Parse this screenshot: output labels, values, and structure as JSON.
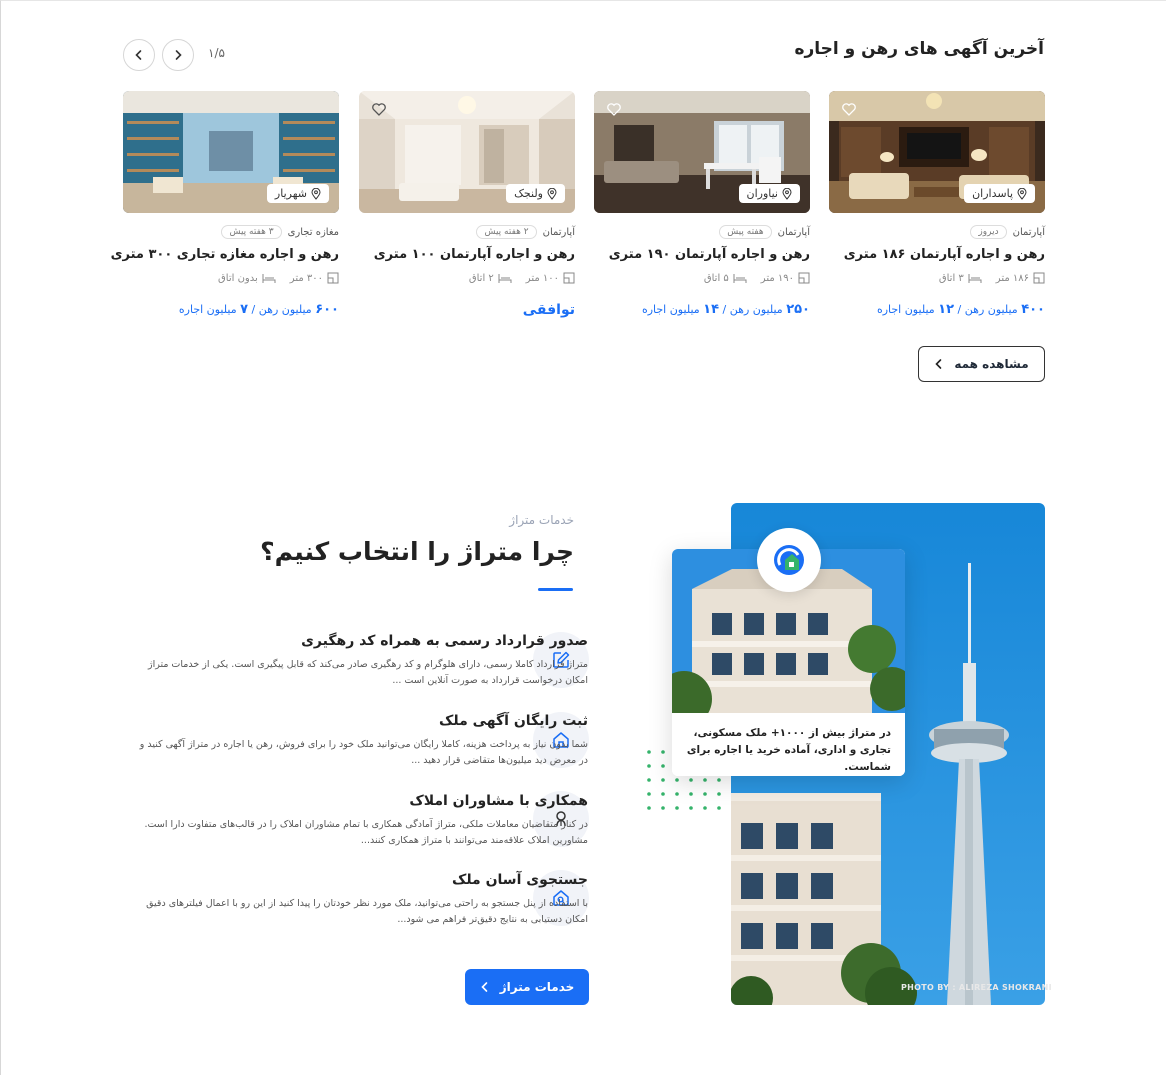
{
  "section_latest": {
    "title": "آخرین آگهی های رهن و اجاره",
    "pager": "۱/۵",
    "prev_icon": "chevron-left-icon",
    "next_icon": "chevron-right-icon",
    "see_all": "مشاهده همه"
  },
  "listings": [
    {
      "location": "پاسداران",
      "category": "آپارتمان",
      "time": "دیروز",
      "title": "رهن و اجاره آپارتمان ۱۸۶ متری",
      "area": "۱۸۶ متر",
      "rooms": "۳ اتاق",
      "deposit_value": "۴۰۰",
      "deposit_label": "میلیون رهن",
      "sep": "/",
      "rent_value": "۱۲",
      "rent_label": "میلیون اجاره"
    },
    {
      "location": "نیاوران",
      "category": "آپارتمان",
      "time": "هفته پیش",
      "title": "رهن و اجاره آپارتمان ۱۹۰ متری",
      "area": "۱۹۰ متر",
      "rooms": "۵ اتاق",
      "deposit_value": "۲۵۰",
      "deposit_label": "میلیون رهن",
      "sep": "/",
      "rent_value": "۱۴",
      "rent_label": "میلیون اجاره"
    },
    {
      "location": "ولنجک",
      "category": "آپارتمان",
      "time": "۲ هفته پیش",
      "title": "رهن و اجاره آپارتمان ۱۰۰ متری",
      "area": "۱۰۰ متر",
      "rooms": "۲ اتاق",
      "price_text": "توافقی"
    },
    {
      "location": "شهریار",
      "category": "مغازه تجاری",
      "time": "۳ هفته پیش",
      "title": "رهن و اجاره مغازه تجاری ۳۰۰ متری",
      "area": "۳۰۰ متر",
      "rooms": "بدون اتاق",
      "deposit_value": "۶۰۰",
      "deposit_label": "میلیون رهن",
      "sep": "/",
      "rent_value": "۷",
      "rent_label": "میلیون اجاره"
    }
  ],
  "services": {
    "label": "خدمات متراژ",
    "title": "چرا متراژ را انتخاب کنیم؟",
    "features": [
      {
        "icon": "edit-icon",
        "title": "صدور قرارداد رسمی به همراه کد رهگیری",
        "text": "متراژ قرارداد کاملا رسمی، دارای هلوگرام و کد رهگیری صادر می‌کند که قابل پیگیری است. یکی از خدمات متراژ امکان درخواست قرارداد به صورت آنلاین است ..."
      },
      {
        "icon": "home-icon",
        "title": "ثبت رایگان آگهی ملک",
        "text": "شما بدون نیاز به پرداخت هزینه، کاملا رایگان می‌توانید ملک خود را برای فروش، رهن یا اجاره در متراژ آگهی کنید و در معرض دید میلیون‌ها متقاضی قرار دهید ..."
      },
      {
        "icon": "advisor-icon",
        "title": "همکاری با مشاوران املاک",
        "text": "در کنار متقاضیان معاملات ملکی، متراژ آمادگی همکاری با تمام مشاوران املاک را در قالب‌های متفاوت دارا است. مشاورین املاک علاقه‌مند می‌توانند با متراژ همکاری کنند..."
      },
      {
        "icon": "house-search-icon",
        "title": "جستجوی آسان ملک",
        "text": "با استفاده از پنل جستجو به راحتی می‌توانید، ملک مورد نظر خودتان را پیدا کنید از این رو با اعمال فیلترهای دقیق امکان دستیابی به نتایج دقیق‌تر فراهم می شود..."
      }
    ],
    "cta": "خدمات متراژ"
  },
  "promo": {
    "text": "در متراژ بیش از ۱۰۰۰+ ملک مسکونی، تجاری و اداری، آماده خرید یا اجاره برای شماست.",
    "photo_credit": "PHOTO BY : ALIREZA SHOKRANI",
    "logo_icon": "matraj-logo-icon"
  },
  "colors": {
    "accent": "#1a6ef5",
    "dots": "#35b36b"
  }
}
